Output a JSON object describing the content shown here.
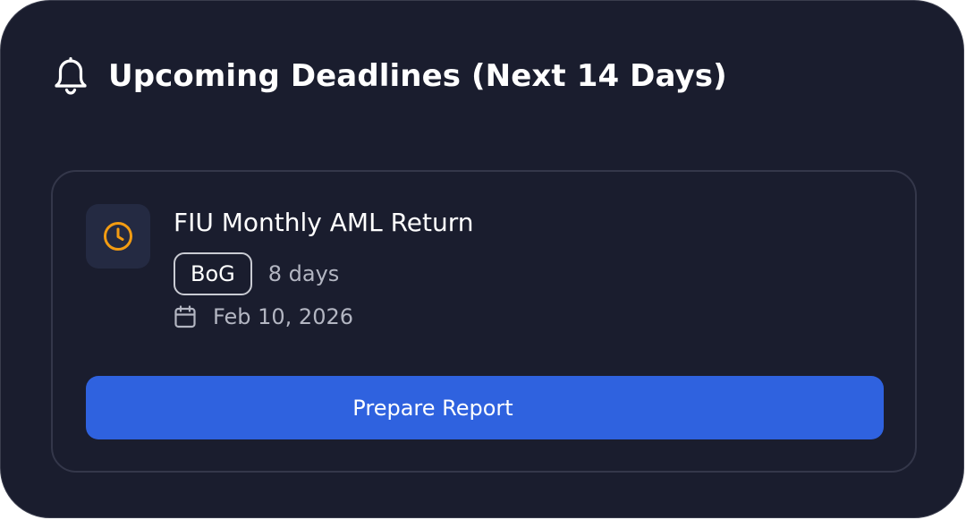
{
  "header": {
    "title": "Upcoming Deadlines (Next 14 Days)",
    "icon": "bell-icon"
  },
  "deadlines": [
    {
      "title": "FIU Monthly AML Return",
      "status_icon": "clock-icon",
      "regulator": "BoG",
      "days_remaining": "8 days",
      "date_icon": "calendar-icon",
      "due_date": "Feb 10, 2026",
      "action_label": "Prepare Report"
    }
  ],
  "colors": {
    "background": "#1a1d2e",
    "card_border": "#34374a",
    "icon_tile": "#242a42",
    "accent_orange": "#f39c12",
    "button_blue": "#2f62df",
    "muted_text": "#b3b6c2"
  }
}
